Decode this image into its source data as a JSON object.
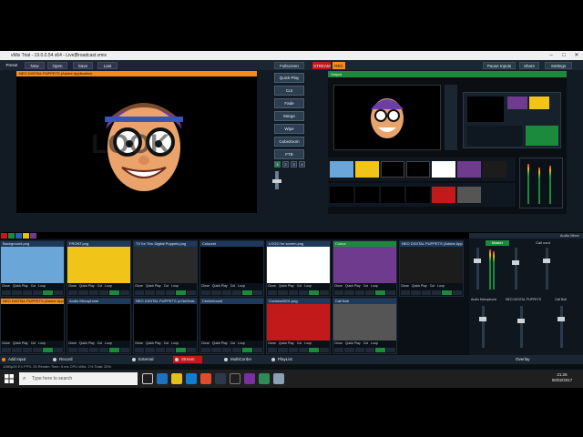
{
  "window": {
    "title": "vMix Trial - 19.0.0.54 x64 - Live|Broadcast.vmix"
  },
  "menu": {
    "preset": "Preset",
    "new": "New",
    "open": "Open",
    "save": "Save",
    "last": "Last",
    "fullscreen": "Fullscreen",
    "stream_label": "STREAM",
    "rec_label": "REC",
    "pause_inputs": "Pause Inputs",
    "share": "Share",
    "settings": "Settings"
  },
  "preview": {
    "header": "NEO DIGITAL PUPPETS (Adobe Application)",
    "logo_text": "LOOK"
  },
  "output": {
    "header": "Output"
  },
  "transitions": {
    "quick_play": "Quick Play",
    "cut": "Cut",
    "fade": "Fade",
    "merge": "Merge",
    "wipe": "Wipe",
    "cube_zoom": "CubeZoom",
    "ftb": "FTB",
    "numbers": [
      "1",
      "2",
      "3",
      "4"
    ]
  },
  "inputs": [
    {
      "n": "1",
      "name": "Background.png",
      "state": "normal",
      "thumb": "#6aa7d8"
    },
    {
      "n": "2",
      "name": "FRONT.png",
      "state": "normal",
      "thumb": "#f0c419"
    },
    {
      "n": "3",
      "name": "TV for Tivu Digital Puppets.png",
      "state": "normal",
      "thumb": "#2a2a2a"
    },
    {
      "n": "4",
      "name": "Colourst",
      "state": "normal",
      "thumb": "#000000"
    },
    {
      "n": "5",
      "name": "LOGO for screen.png",
      "state": "normal",
      "thumb": "#ffffff"
    },
    {
      "n": "6",
      "name": "Colour",
      "state": "green",
      "thumb": "#6f3b8f"
    },
    {
      "n": "7",
      "name": "NEO DIGITAL PUPPETS (Adobe App",
      "state": "normal",
      "thumb": "#1c1c1c"
    },
    {
      "n": "8",
      "name": "NEO DIGITAL PUPPETS (Adobe App",
      "state": "orange",
      "thumb": "#000000"
    },
    {
      "n": "9",
      "name": "Audio Microphone",
      "state": "normal",
      "thumb": "#000000"
    },
    {
      "n": "10",
      "name": "NEO DIGITAL PUPPETS (z:NeDesk",
      "state": "normal",
      "thumb": "#000000"
    },
    {
      "n": "11",
      "name": "Centerround",
      "state": "normal",
      "thumb": "#000000"
    },
    {
      "n": "12",
      "name": "Curtains0001.png",
      "state": "normal",
      "thumb": "#c21a1a"
    },
    {
      "n": "13",
      "name": "Call Bob",
      "state": "normal",
      "thumb": "#555555"
    }
  ],
  "card_controls": {
    "close": "Close",
    "quick_play": "Quick Play",
    "cut": "Cut",
    "loop": "Loop",
    "audio": "Audio"
  },
  "audio_mixer": {
    "header": "Audio Mixer",
    "master": "Master",
    "call": "Call cord",
    "audio_mic": "Audio Microphone",
    "neo_dp": "NEO DIGITAL PUPPETS",
    "call_bob": "Call Bob"
  },
  "bottom_bar": {
    "add_input": "Add Input",
    "record": "Record",
    "external": "External",
    "stream": "Stream",
    "multicorder": "MultiCorder",
    "playlist": "PlayList",
    "overlay": "Overlay"
  },
  "status": {
    "text": "1080p25   EX   FPS: 25   Render Time: 5 ms   CPU vMix: 1%   Total: 20%"
  },
  "taskbar": {
    "search_placeholder": "Type here to search",
    "time": "21:25",
    "date": "06/02/2017"
  },
  "colors": {
    "accent_orange": "#f28d1b",
    "accent_green": "#1c8a3c",
    "panel_bg": "#121a23"
  }
}
